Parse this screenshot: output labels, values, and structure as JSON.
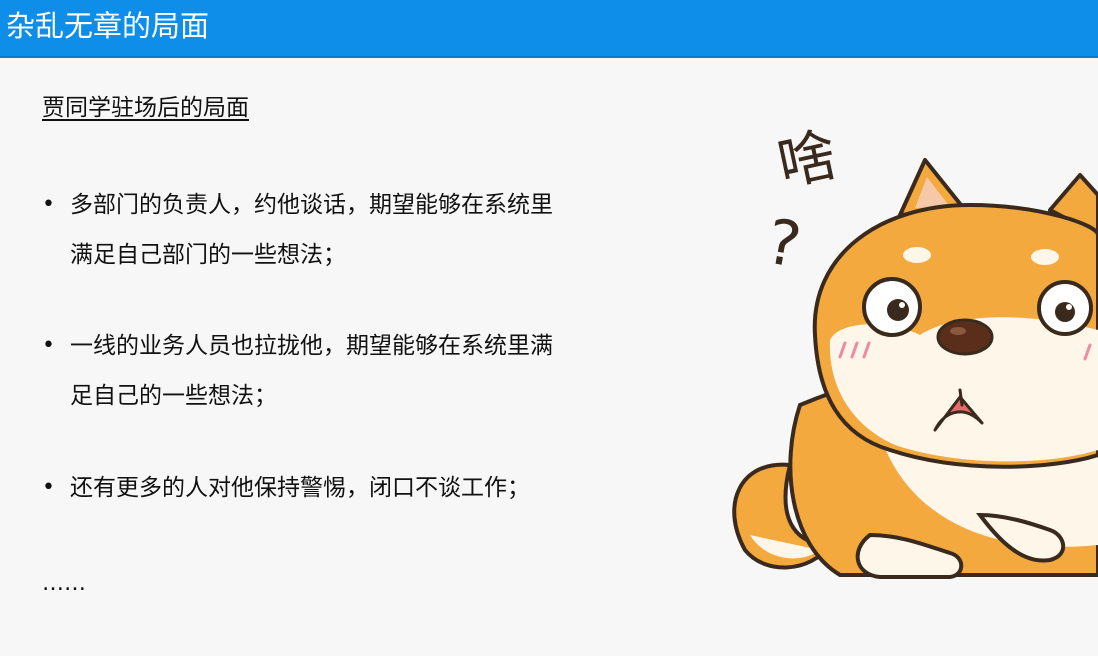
{
  "slide": {
    "title": "杂乱无章的局面",
    "subtitle": "贾同学驻场后的局面",
    "bullets": [
      {
        "marker": "•",
        "lines": [
          "多部门的负责人，约他谈话，期望能够在系统里",
          "满足自己部门的一些想法；"
        ]
      },
      {
        "marker": "•",
        "lines": [
          "一线的业务人员也拉拢他，期望能够在系统里满",
          "足自己的一些想法；"
        ]
      },
      {
        "marker": "•",
        "lines": [
          "还有更多的人对他保持警惕，闭口不谈工作；"
        ]
      }
    ],
    "ellipsis": "……",
    "illustration": {
      "icon": "confused-shiba-dog-icon",
      "exclamation": "啥",
      "question": "?"
    }
  },
  "colors": {
    "title_bar": "#0e8ee8",
    "background": "#f7f7f7",
    "text": "#111111",
    "dog_fur": "#f3a93e",
    "dog_outline": "#3a2a1e",
    "dog_cream": "#fff6ea"
  }
}
